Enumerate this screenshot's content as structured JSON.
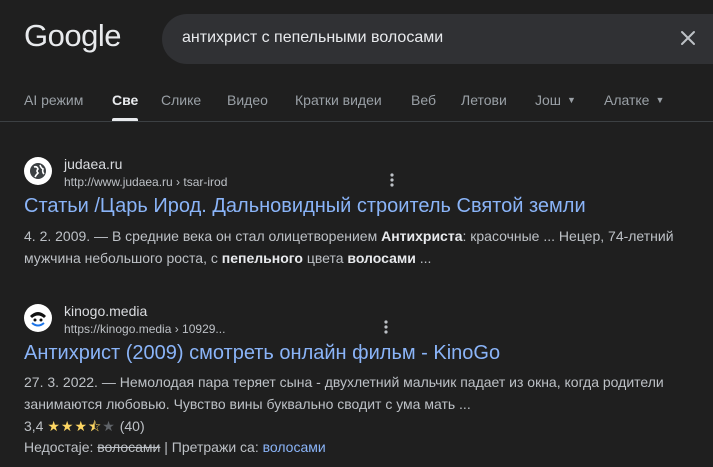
{
  "header": {
    "logo": "Google",
    "query": "антихрист с пепельными волосами"
  },
  "tabs": [
    {
      "label": "AI режим"
    },
    {
      "label": "Све"
    },
    {
      "label": "Слике"
    },
    {
      "label": "Видео"
    },
    {
      "label": "Кратки видеи"
    },
    {
      "label": "Веб"
    },
    {
      "label": "Летови"
    },
    {
      "label": "Још"
    },
    {
      "label": "Алатке"
    }
  ],
  "results": [
    {
      "site": "judaea.ru",
      "url": "http://www.judaea.ru › tsar-irod",
      "title": "Статьи /Царь Ирод. Дальновидный строитель Святой земли",
      "snippet": {
        "date": "4. 2. 2009.",
        "sep": " — ",
        "p1": "В средние века он стал олицетворением ",
        "b1": "Антихриста",
        "p2": ": красочные ... Нецер, 74-летний мужчина небольшого роста, с ",
        "b2": "пепельного",
        "p3": " цвета ",
        "b3": "волосами",
        "p4": " ..."
      }
    },
    {
      "site": "kinogo.media",
      "url": "https://kinogo.media › 10929...",
      "title": "Антихрист (2009) смотреть онлайн фильм - KinoGo",
      "snippet": {
        "date": "27. 3. 2022.",
        "sep": " — ",
        "text": "Немолодая пара теряет сына - двухлетний мальчик падает из окна, когда родители занимаются любовью. Чувство вины буквально сводит с ума мать ..."
      },
      "rating": {
        "value": "3,4",
        "stars": 3.4,
        "count": "(40)"
      },
      "missing": {
        "label": "Недостаје:",
        "word": "волосами",
        "sep": "|",
        "search_label": "Претражи са:",
        "search_word": "волосами"
      }
    }
  ],
  "colors": {
    "background": "#1f1f1f",
    "link": "#8ab4f8",
    "star": "#fdd663"
  }
}
